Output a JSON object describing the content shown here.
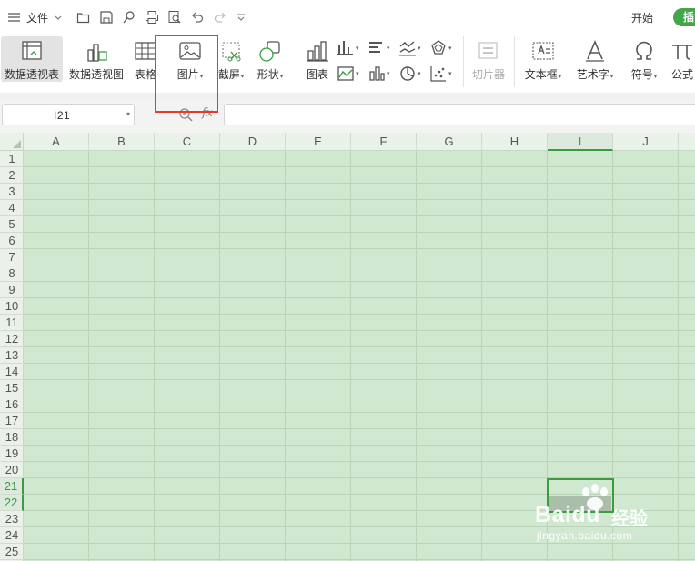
{
  "menubar": {
    "file_label": "文件",
    "tabs": {
      "start": "开始",
      "insert": "插"
    }
  },
  "ribbon": {
    "pivot_table": "数据透视表",
    "pivot_chart": "数据透视图",
    "table": "表格",
    "picture": "图片",
    "screenshot": "截屏",
    "shapes": "形状",
    "chart": "图表",
    "slicer": "切片器",
    "textbox": "文本框",
    "wordart": "艺术字",
    "symbol": "符号",
    "formula": "公式"
  },
  "formula_bar": {
    "name_box": "I21",
    "fx_label": "fx",
    "formula_value": ""
  },
  "sheet": {
    "columns": [
      "A",
      "B",
      "C",
      "D",
      "E",
      "F",
      "G",
      "H",
      "I",
      "J"
    ],
    "rows": [
      "1",
      "2",
      "3",
      "4",
      "5",
      "6",
      "7",
      "8",
      "9",
      "10",
      "11",
      "12",
      "13",
      "14",
      "15",
      "16",
      "17",
      "18",
      "19",
      "20",
      "21",
      "22",
      "23",
      "24",
      "25"
    ],
    "active_column": "I",
    "active_rows": [
      "21",
      "22"
    ],
    "selected_range": "I21:I22"
  },
  "colors": {
    "grid_background": "#cfe8cf",
    "accent": "#42a64a",
    "highlight": "#e8392b"
  },
  "watermark": {
    "brand": "Baidu",
    "brand_cn": "经验",
    "url": "jingyan.baidu.com"
  }
}
